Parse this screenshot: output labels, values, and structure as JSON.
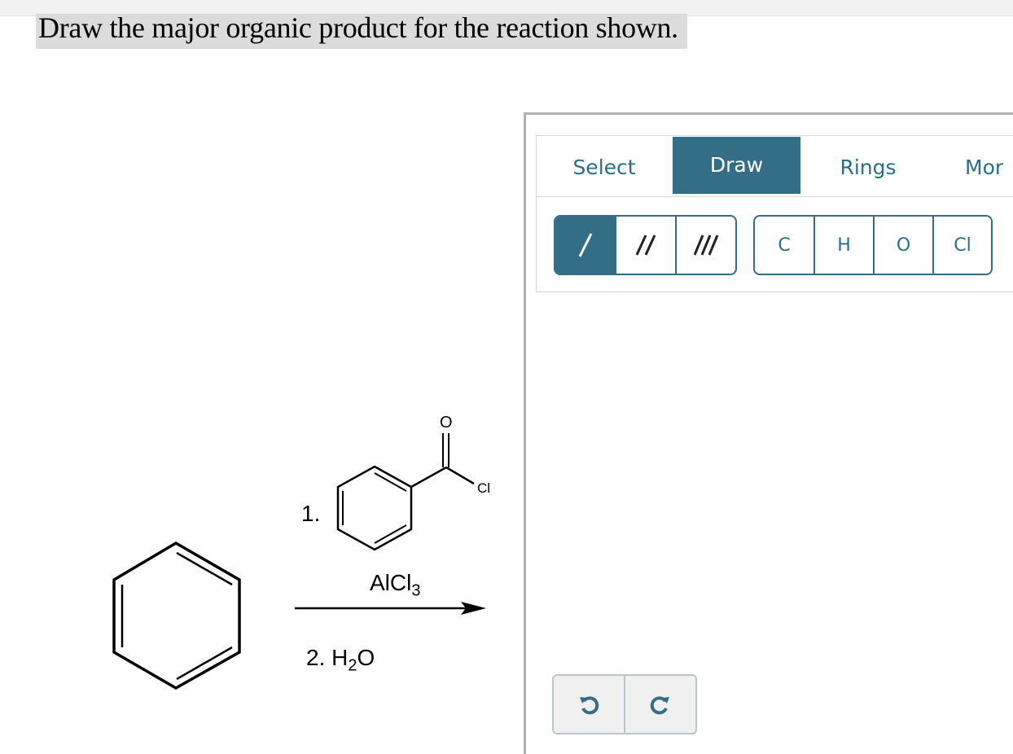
{
  "question": {
    "text": "Draw the major organic product for the reaction shown."
  },
  "reaction": {
    "step1_number": "1.",
    "step1_reagent_main": "AlCl",
    "step1_reagent_sub": "3",
    "acyl_oxygen": "O",
    "acyl_chlorine": "Cl",
    "step2_prefix": "2. H",
    "step2_sub": "2",
    "step2_suffix": "O"
  },
  "editor": {
    "tabs": [
      "Select",
      "Draw",
      "Rings",
      "Mor"
    ],
    "active_tab": "Draw",
    "bond_buttons": [
      "single-bond",
      "double-bond",
      "triple-bond"
    ],
    "active_bond": "single-bond",
    "atom_buttons": [
      "C",
      "H",
      "O",
      "Cl"
    ],
    "accent_color": "#336e86"
  }
}
